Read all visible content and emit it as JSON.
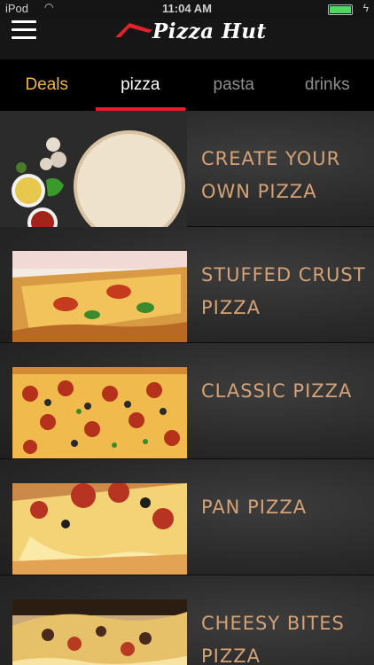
{
  "status_bar": {
    "carrier": "iPod",
    "time": "11:04 AM"
  },
  "header": {
    "logo_text": "Pizza Hut",
    "menu_icon": "hamburger-menu-icon"
  },
  "tabs": [
    {
      "label": "Deals"
    },
    {
      "label": "pizza"
    },
    {
      "label": "pasta"
    },
    {
      "label": "drinks"
    }
  ],
  "menu_items": [
    {
      "label": "CREATE YOUR OWN PIZZA"
    },
    {
      "label": "STUFFED CRUST PIZZA"
    },
    {
      "label": "CLASSIC PIZZA"
    },
    {
      "label": "PAN PIZZA"
    },
    {
      "label": "CHEESY BITES PIZZA"
    }
  ],
  "colors": {
    "accent_red": "#e1222b",
    "deals_gold": "#f0b543",
    "item_label": "#d4a277",
    "battery_green": "#4cd964"
  }
}
